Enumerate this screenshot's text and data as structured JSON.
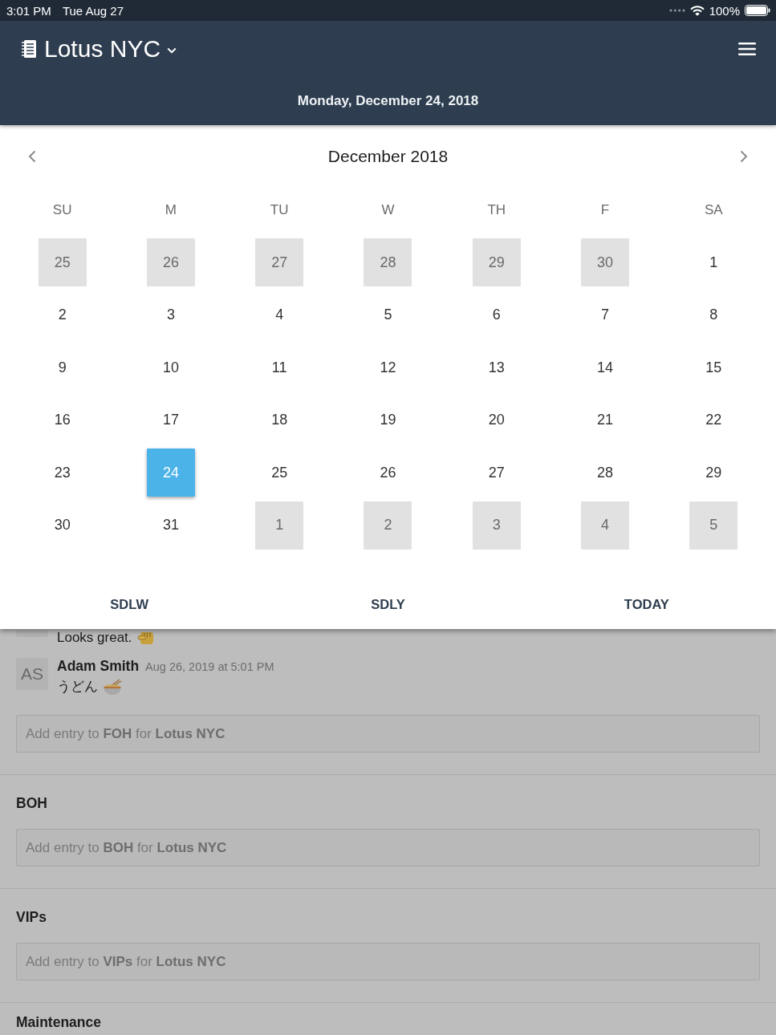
{
  "status_bar": {
    "time": "3:01 PM",
    "date": "Tue Aug 27",
    "battery": "100%"
  },
  "header": {
    "title": "Lotus NYC",
    "date": "Monday, December 24, 2018"
  },
  "calendar": {
    "month": "December 2018",
    "weekdays": [
      "SU",
      "M",
      "TU",
      "W",
      "TH",
      "F",
      "SA"
    ],
    "days": [
      {
        "label": "25",
        "other_month": true,
        "selected": false
      },
      {
        "label": "26",
        "other_month": true,
        "selected": false
      },
      {
        "label": "27",
        "other_month": true,
        "selected": false
      },
      {
        "label": "28",
        "other_month": true,
        "selected": false
      },
      {
        "label": "29",
        "other_month": true,
        "selected": false
      },
      {
        "label": "30",
        "other_month": true,
        "selected": false
      },
      {
        "label": "1",
        "other_month": false,
        "selected": false
      },
      {
        "label": "2",
        "other_month": false,
        "selected": false
      },
      {
        "label": "3",
        "other_month": false,
        "selected": false
      },
      {
        "label": "4",
        "other_month": false,
        "selected": false
      },
      {
        "label": "5",
        "other_month": false,
        "selected": false
      },
      {
        "label": "6",
        "other_month": false,
        "selected": false
      },
      {
        "label": "7",
        "other_month": false,
        "selected": false
      },
      {
        "label": "8",
        "other_month": false,
        "selected": false
      },
      {
        "label": "9",
        "other_month": false,
        "selected": false
      },
      {
        "label": "10",
        "other_month": false,
        "selected": false
      },
      {
        "label": "11",
        "other_month": false,
        "selected": false
      },
      {
        "label": "12",
        "other_month": false,
        "selected": false
      },
      {
        "label": "13",
        "other_month": false,
        "selected": false
      },
      {
        "label": "14",
        "other_month": false,
        "selected": false
      },
      {
        "label": "15",
        "other_month": false,
        "selected": false
      },
      {
        "label": "16",
        "other_month": false,
        "selected": false
      },
      {
        "label": "17",
        "other_month": false,
        "selected": false
      },
      {
        "label": "18",
        "other_month": false,
        "selected": false
      },
      {
        "label": "19",
        "other_month": false,
        "selected": false
      },
      {
        "label": "20",
        "other_month": false,
        "selected": false
      },
      {
        "label": "21",
        "other_month": false,
        "selected": false
      },
      {
        "label": "22",
        "other_month": false,
        "selected": false
      },
      {
        "label": "23",
        "other_month": false,
        "selected": false
      },
      {
        "label": "24",
        "other_month": false,
        "selected": true
      },
      {
        "label": "25",
        "other_month": false,
        "selected": false
      },
      {
        "label": "26",
        "other_month": false,
        "selected": false
      },
      {
        "label": "27",
        "other_month": false,
        "selected": false
      },
      {
        "label": "28",
        "other_month": false,
        "selected": false
      },
      {
        "label": "29",
        "other_month": false,
        "selected": false
      },
      {
        "label": "30",
        "other_month": false,
        "selected": false
      },
      {
        "label": "31",
        "other_month": false,
        "selected": false
      },
      {
        "label": "1",
        "other_month": true,
        "selected": false
      },
      {
        "label": "2",
        "other_month": true,
        "selected": false
      },
      {
        "label": "3",
        "other_month": true,
        "selected": false
      },
      {
        "label": "4",
        "other_month": true,
        "selected": false
      },
      {
        "label": "5",
        "other_month": true,
        "selected": false
      }
    ],
    "shortcuts": [
      "SDLW",
      "SDLY",
      "TODAY"
    ]
  },
  "feed": {
    "messages": [
      {
        "kind": "partial",
        "text": "Looks great."
      },
      {
        "kind": "full",
        "initials": "AS",
        "author": "Adam Smith",
        "time": "Aug 26, 2019 at 5:01 PM",
        "text": "うどん"
      }
    ],
    "entry": {
      "placeholder": "Add entry to **FOH** for **Lotus NYC**"
    }
  },
  "sections": [
    {
      "title": "BOH",
      "entry": {
        "placeholder": "Add entry to **BOH** for **Lotus NYC**"
      }
    },
    {
      "title": "VIPs",
      "entry": {
        "placeholder": "Add entry to **VIPs** for **Lotus NYC**"
      }
    },
    {
      "title": "Maintenance"
    }
  ]
}
